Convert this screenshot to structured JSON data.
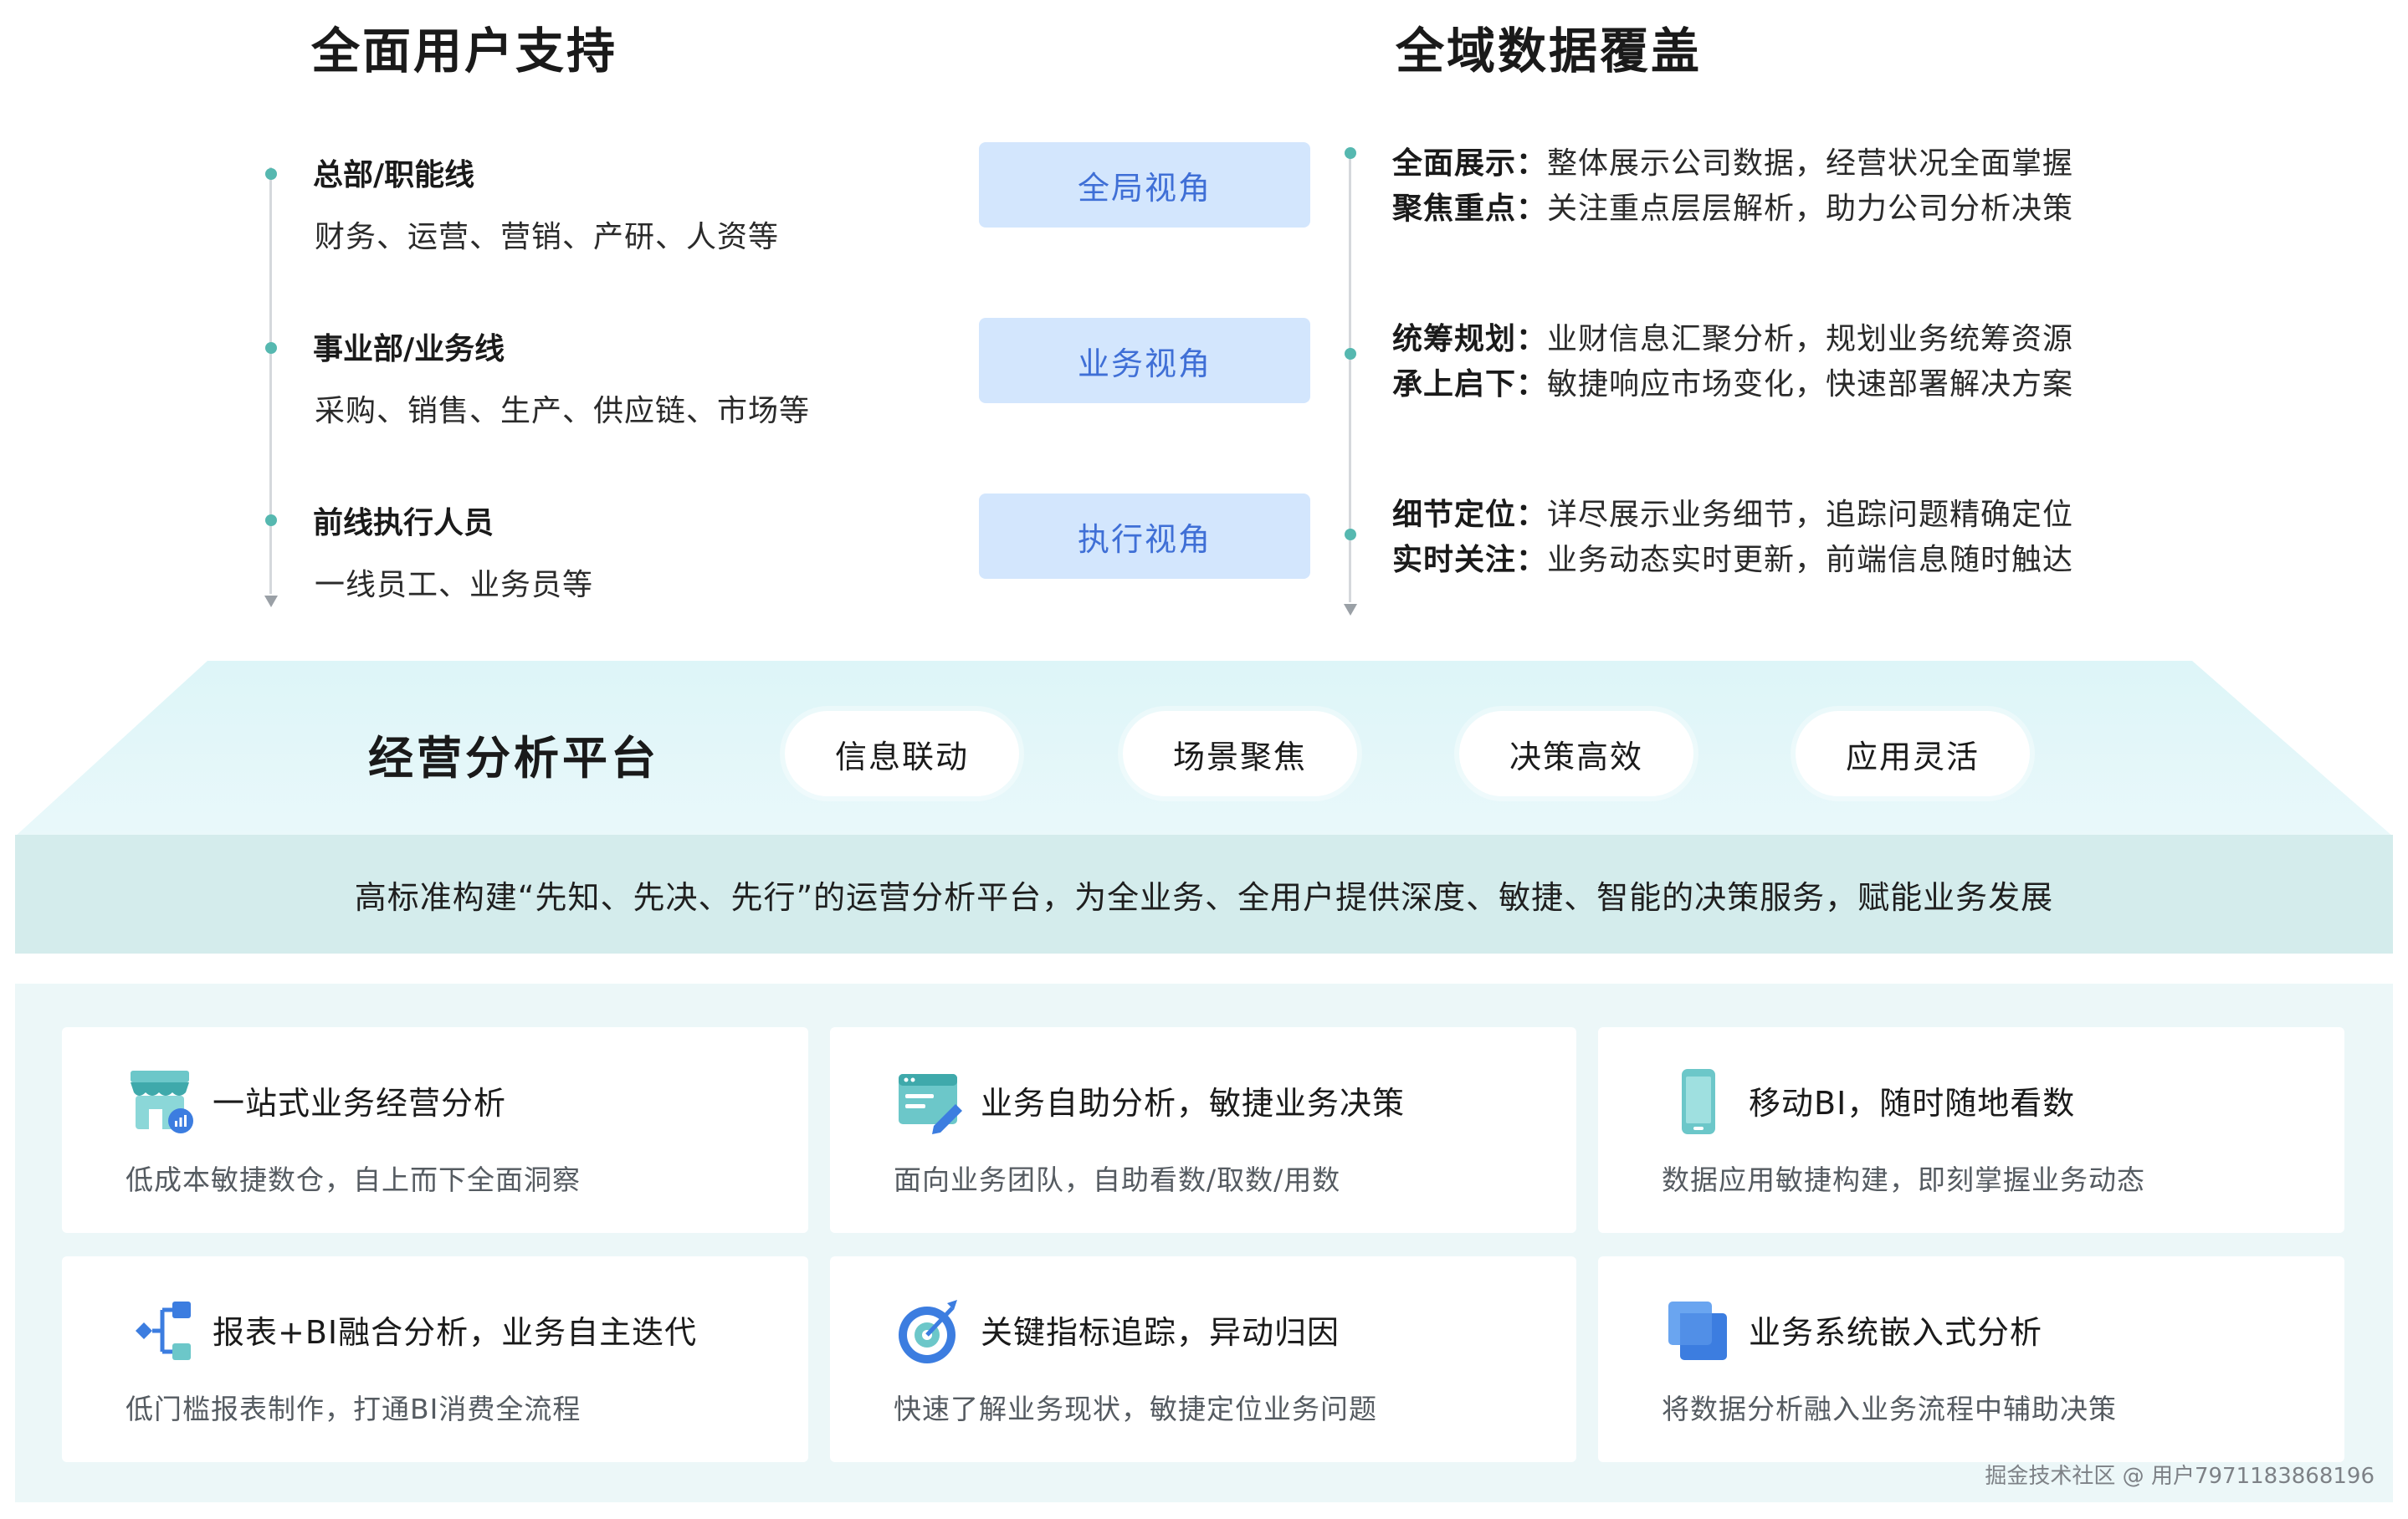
{
  "user_support": {
    "title": "全面用户支持",
    "groups": [
      {
        "title": "总部/职能线",
        "desc": "财务、运营、营销、产研、人资等",
        "view": "全局视角"
      },
      {
        "title": "事业部/业务线",
        "desc": "采购、销售、生产、供应链、市场等",
        "view": "业务视角"
      },
      {
        "title": "前线执行人员",
        "desc": "一线员工、业务员等",
        "view": "执行视角"
      }
    ]
  },
  "data_coverage": {
    "title": "全域数据覆盖",
    "items": [
      {
        "label": "全面展示：",
        "text": "整体展示公司数据，经营状况全面掌握"
      },
      {
        "label": "聚焦重点：",
        "text": "关注重点层层解析，助力公司分析决策"
      },
      {
        "label": "统筹规划：",
        "text": "业财信息汇聚分析，规划业务统筹资源"
      },
      {
        "label": "承上启下：",
        "text": "敏捷响应市场变化，快速部署解决方案"
      },
      {
        "label": "细节定位：",
        "text": "详尽展示业务细节，追踪问题精确定位"
      },
      {
        "label": "实时关注：",
        "text": "业务动态实时更新，前端信息随时触达"
      }
    ]
  },
  "platform": {
    "title": "经营分析平台",
    "pills": [
      "信息联动",
      "场景聚焦",
      "决策高效",
      "应用灵活"
    ],
    "band": "高标准构建“先知、先决、先行”的运营分析平台，为全业务、全用户提供深度、敏捷、智能的决策服务，赋能业务发展"
  },
  "features": [
    {
      "icon": "store-chart-icon",
      "title": "一站式业务经营分析",
      "desc": "低成本敏捷数仓，自上而下全面洞察"
    },
    {
      "icon": "browser-pen-icon",
      "title": "业务自助分析，敏捷业务决策",
      "desc": "面向业务团队，自助看数/取数/用数"
    },
    {
      "icon": "mobile-phone-icon",
      "title": "移动BI，随时随地看数",
      "desc": "数据应用敏捷构建，即刻掌握业务动态"
    },
    {
      "icon": "flow-branch-icon",
      "title": "报表+BI融合分析，业务自主迭代",
      "desc": "低门槛报表制作，打通BI消费全流程"
    },
    {
      "icon": "target-arrow-icon",
      "title": "关键指标追踪，异动归因",
      "desc": "快速了解业务现状，敏捷定位业务问题"
    },
    {
      "icon": "embed-window-icon",
      "title": "业务系统嵌入式分析",
      "desc": "将数据分析融入业务流程中辅助决策"
    }
  ],
  "colors": {
    "accent_blue": "#3f6fd6",
    "view_button_bg": "#d3e6fd",
    "platform_teal": "#d4ecec",
    "dot_teal": "#56b8b0"
  },
  "watermark": "掘金技术社区 @ 用户7971183868196"
}
